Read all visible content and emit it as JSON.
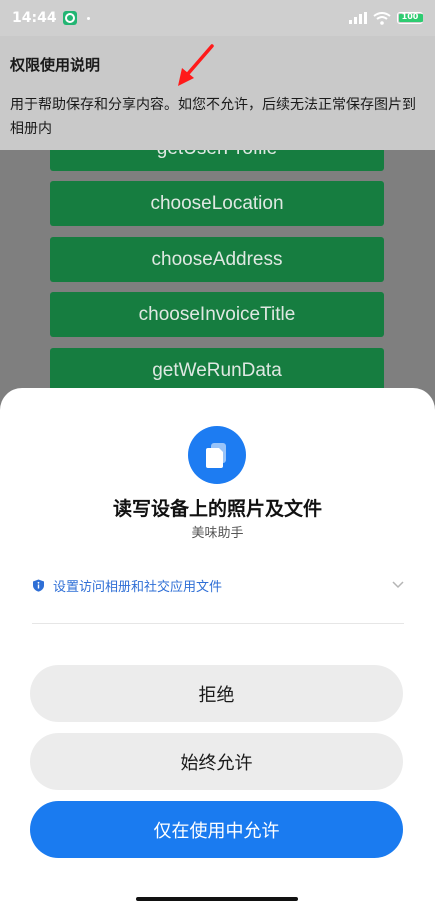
{
  "status_bar": {
    "time": "14:44",
    "battery": "100"
  },
  "permission_banner": {
    "title": "权限使用说明",
    "body": "用于帮助保存和分享内容。如您不允许，后续无法正常保存图片到相册内"
  },
  "background_buttons": [
    "getUserProfile",
    "chooseLocation",
    "chooseAddress",
    "chooseInvoiceTitle",
    "getWeRunData"
  ],
  "dialog": {
    "title": "读写设备上的照片及文件",
    "app_name": "美味助手",
    "info_text": "设置访问相册和社交应用文件",
    "deny_label": "拒绝",
    "always_label": "始终允许",
    "while_using_label": "仅在使用中允许"
  },
  "colors": {
    "primary": "#1a7bf0",
    "button_green": "#167d40",
    "arrow_red": "#ff1a1a"
  }
}
